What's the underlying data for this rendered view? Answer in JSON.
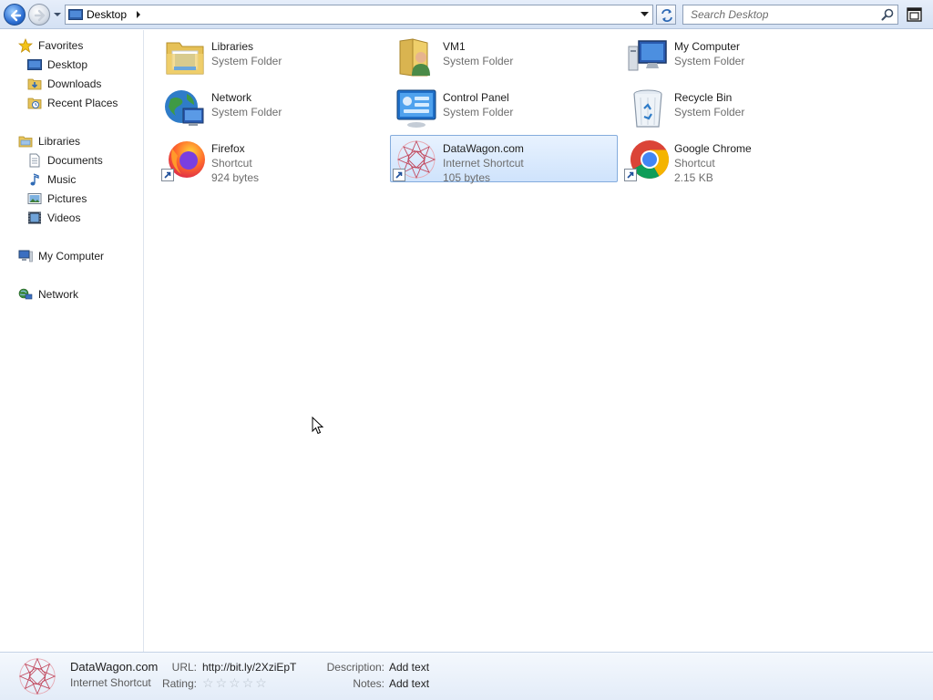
{
  "toolbar": {
    "address": "Desktop",
    "search_placeholder": "Search Desktop"
  },
  "sidebar": {
    "favorites": {
      "label": "Favorites",
      "items": [
        {
          "label": "Desktop",
          "icon": "desktop-icon"
        },
        {
          "label": "Downloads",
          "icon": "downloads-icon"
        },
        {
          "label": "Recent Places",
          "icon": "recent-places-icon"
        }
      ]
    },
    "libraries": {
      "label": "Libraries",
      "items": [
        {
          "label": "Documents",
          "icon": "documents-icon"
        },
        {
          "label": "Music",
          "icon": "music-icon"
        },
        {
          "label": "Pictures",
          "icon": "pictures-icon"
        },
        {
          "label": "Videos",
          "icon": "videos-icon"
        }
      ]
    },
    "computer": {
      "label": "My Computer"
    },
    "network": {
      "label": "Network"
    }
  },
  "items": [
    {
      "name": "Libraries",
      "type": "System Folder",
      "size": "",
      "icon": "libraries-icon"
    },
    {
      "name": "VM1",
      "type": "System Folder",
      "size": "",
      "icon": "user-folder-icon"
    },
    {
      "name": "My Computer",
      "type": "System Folder",
      "size": "",
      "icon": "computer-icon"
    },
    {
      "name": "Network",
      "type": "System Folder",
      "size": "",
      "icon": "network-icon"
    },
    {
      "name": "Control Panel",
      "type": "System Folder",
      "size": "",
      "icon": "control-panel-icon"
    },
    {
      "name": "Recycle Bin",
      "type": "System Folder",
      "size": "",
      "icon": "recycle-bin-icon"
    },
    {
      "name": "Firefox",
      "type": "Shortcut",
      "size": "924 bytes",
      "icon": "firefox-icon"
    },
    {
      "name": "DataWagon.com",
      "type": "Internet Shortcut",
      "size": "105 bytes",
      "icon": "datawagon-icon",
      "selected": true
    },
    {
      "name": "Google Chrome",
      "type": "Shortcut",
      "size": "2.15 KB",
      "icon": "chrome-icon"
    }
  ],
  "details": {
    "name": "DataWagon.com",
    "type": "Internet Shortcut",
    "url_label": "URL:",
    "url_value": "http://bit.ly/2XziEpT",
    "rating_label": "Rating:",
    "rating_value": 0,
    "rating_max": 5,
    "description_label": "Description:",
    "description_value": "Add text",
    "notes_label": "Notes:",
    "notes_value": "Add text"
  },
  "colors": {
    "selection_bg": "#cfe3fc",
    "selection_border": "#84acdd",
    "toolbar_bg": "#dce7f6"
  }
}
